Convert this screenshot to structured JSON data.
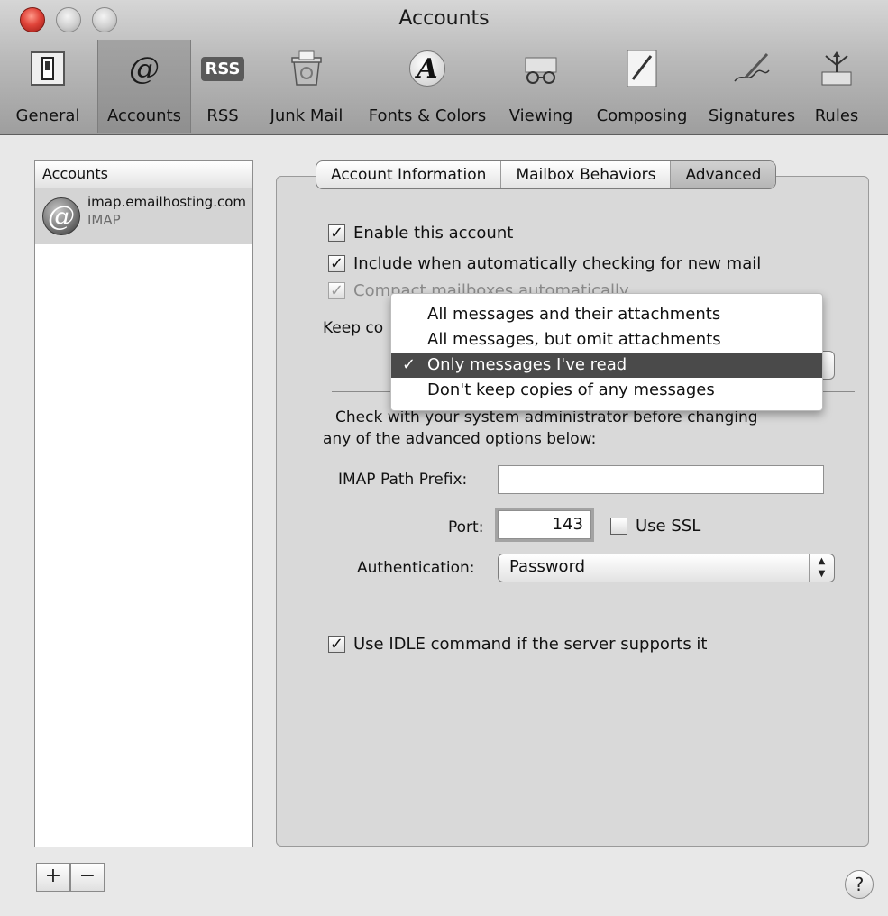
{
  "window": {
    "title": "Accounts"
  },
  "toolbar": {
    "items": [
      {
        "label": "General",
        "icon": "switch-icon"
      },
      {
        "label": "Accounts",
        "icon": "at-sign-icon"
      },
      {
        "label": "RSS",
        "icon": "rss-icon"
      },
      {
        "label": "Junk Mail",
        "icon": "trash-bin-icon"
      },
      {
        "label": "Fonts & Colors",
        "icon": "font-icon"
      },
      {
        "label": "Viewing",
        "icon": "glasses-icon"
      },
      {
        "label": "Composing",
        "icon": "pencil-paper-icon"
      },
      {
        "label": "Signatures",
        "icon": "pen-signature-icon"
      },
      {
        "label": "Rules",
        "icon": "rules-arrows-icon"
      }
    ],
    "selected": "Accounts",
    "rss_badge": "RSS",
    "at_glyph": "@",
    "font_glyph": "A"
  },
  "sidebar": {
    "header": "Accounts",
    "accounts": [
      {
        "name": "imap.emailhosting.com",
        "type": "IMAP",
        "glyph": "@"
      }
    ],
    "add_label": "+",
    "remove_label": "−"
  },
  "tabs": [
    {
      "label": "Account Information"
    },
    {
      "label": "Mailbox Behaviors"
    },
    {
      "label": "Advanced"
    }
  ],
  "active_tab": "Advanced",
  "options": {
    "enable_account": {
      "label": "Enable this account",
      "checked": true
    },
    "include_auto_check": {
      "label": "Include when automatically checking for new mail",
      "checked": true
    },
    "compact_mailboxes": {
      "label": "Compact mailboxes automatically",
      "checked": true,
      "enabled": false
    },
    "keep_copies_label": "Keep co",
    "admin_note_line1": "Check with your system administrator before changing",
    "admin_note_line2": "any of the advanced options below:",
    "imap_path_prefix": {
      "label": "IMAP Path Prefix:",
      "value": ""
    },
    "port": {
      "label": "Port:",
      "value": "143"
    },
    "use_ssl": {
      "label": "Use SSL",
      "checked": false
    },
    "authentication": {
      "label": "Authentication:",
      "value": "Password"
    },
    "use_idle": {
      "label": "Use IDLE command if the server supports it",
      "checked": true
    }
  },
  "menu": {
    "items": [
      {
        "label": "All messages and their attachments",
        "selected": false
      },
      {
        "label": "All messages, but omit attachments",
        "selected": false
      },
      {
        "label": "Only messages I've read",
        "selected": true
      },
      {
        "label": "Don't keep copies of any messages",
        "selected": false
      }
    ],
    "check_glyph": "✓"
  },
  "help_label": "?",
  "check_glyph": "✓",
  "colors": {
    "menu_highlight": "#4a4a4a",
    "close_button": "#e0443a",
    "list_selection": "#d4d4d4"
  }
}
